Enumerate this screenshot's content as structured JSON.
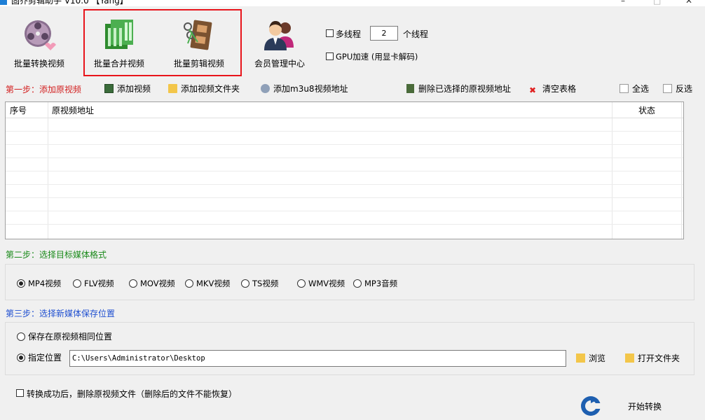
{
  "window": {
    "title": "固乔剪辑助手 V10.0 【Yang】",
    "controls": {
      "minimize": "–",
      "maximize": "□",
      "close": "✕"
    }
  },
  "toolbar": {
    "batch_convert": "批量转换视频",
    "batch_merge": "批量合并视频",
    "batch_edit": "批量剪辑视频",
    "member_center": "会员管理中心",
    "multithread_label": "多线程",
    "thread_count": "2",
    "thread_unit": "个线程",
    "gpu_label": "GPU加速 (用显卡解码)"
  },
  "step1": {
    "label": "第一步：添加原视频",
    "add_video": "添加视频",
    "add_folder": "添加视频文件夹",
    "add_m3u8": "添加m3u8视频地址",
    "delete_selected": "删除已选择的原视频地址",
    "clear_table": "清空表格",
    "select_all": "全选",
    "invert": "反选"
  },
  "table": {
    "columns": [
      "序号",
      "原视频地址",
      "状态"
    ]
  },
  "step2": {
    "label": "第二步：选择目标媒体格式",
    "formats": [
      "MP4视频",
      "FLV视频",
      "MOV视频",
      "MKV视频",
      "TS视频",
      "WMV视频",
      "MP3音频"
    ],
    "selected": "MP4视频"
  },
  "step3": {
    "label": "第三步：选择新媒体保存位置",
    "same_location": "保存在原视频相同位置",
    "specify": "指定位置",
    "path": "C:\\Users\\Administrator\\Desktop",
    "browse": "浏览",
    "open_folder": "打开文件夹"
  },
  "footer": {
    "delete_original": "转换成功后，删除原视频文件（删除后的文件不能恢复）",
    "start": "开始转换"
  },
  "colors": {
    "highlight": "#e8141b",
    "step1": "#d21f1f",
    "step2": "#1a8a1a",
    "step3": "#1f4fd0"
  }
}
